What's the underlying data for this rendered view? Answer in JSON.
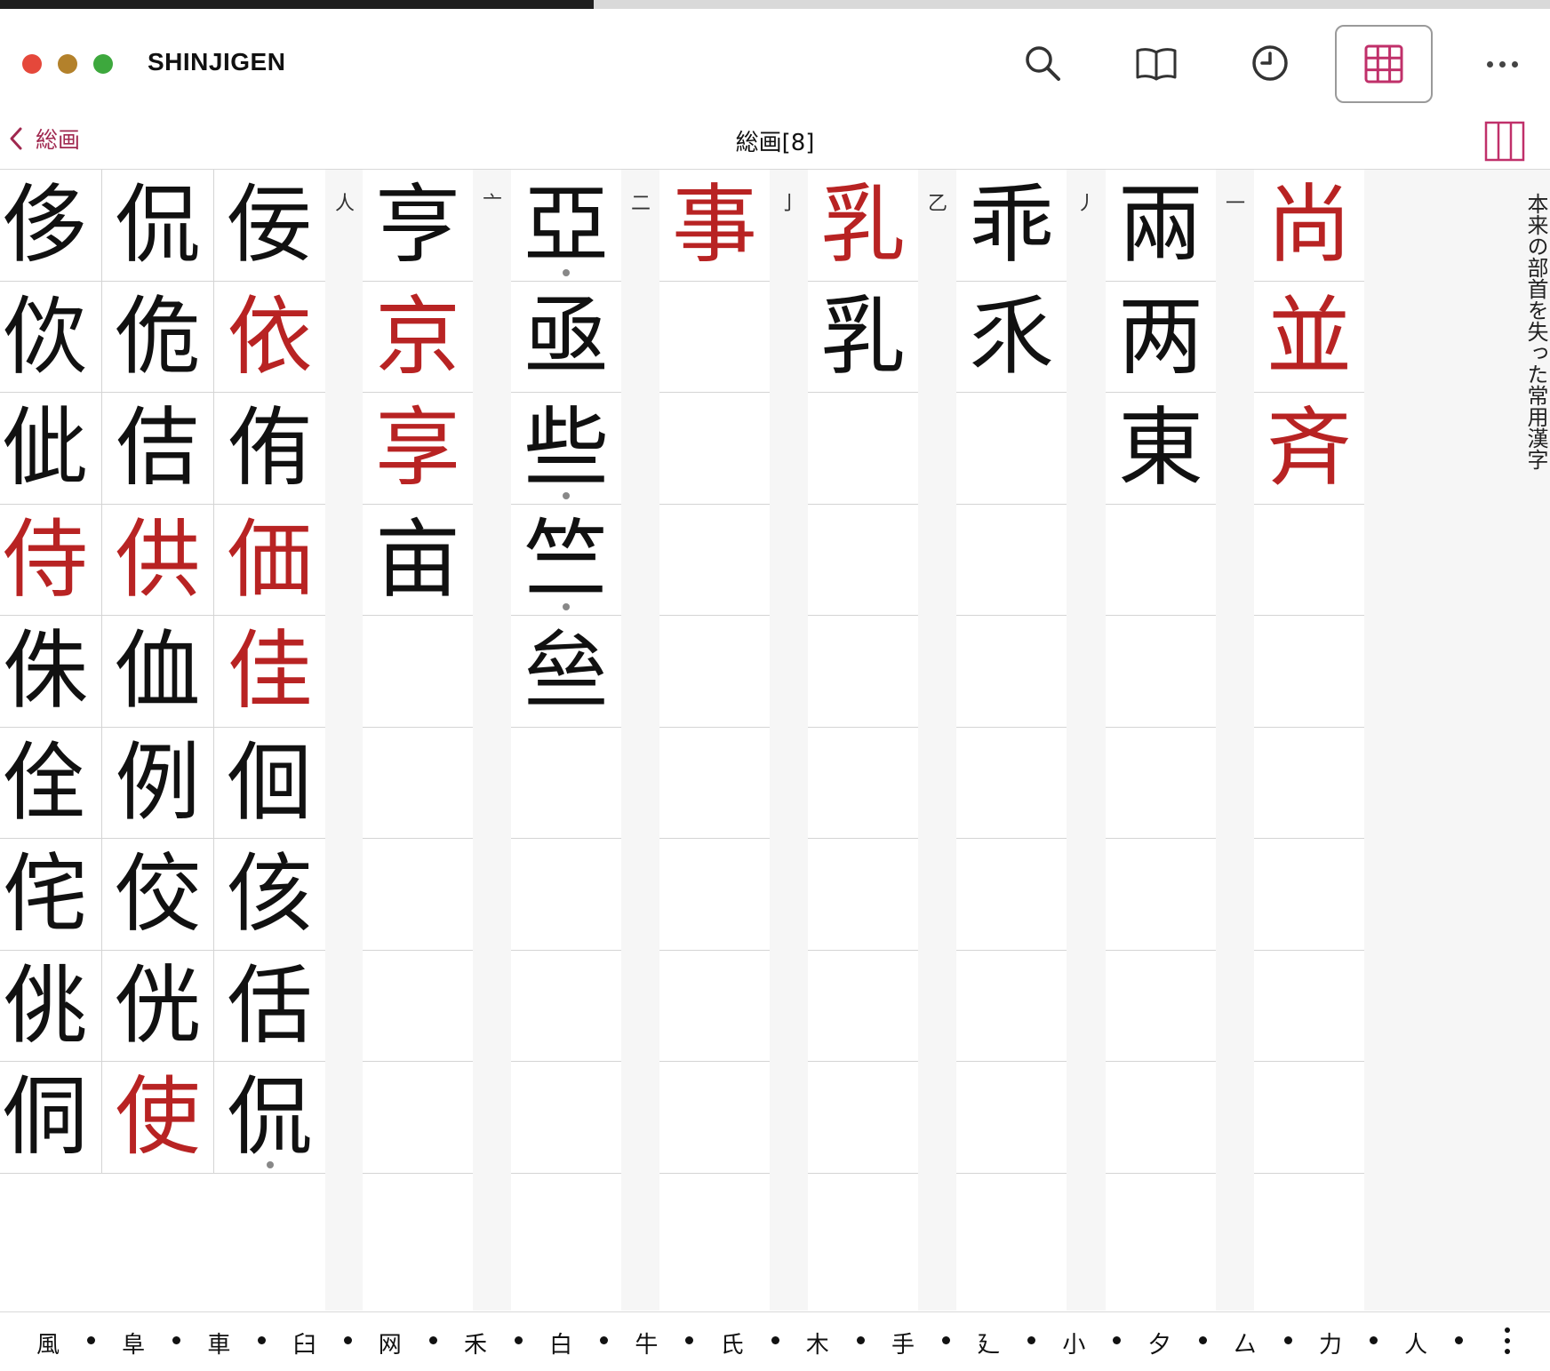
{
  "window": {
    "title": "SHINJIGEN"
  },
  "toolbar": {
    "search_icon": "search-icon",
    "book_icon": "book-icon",
    "history_icon": "clock-icon",
    "grid_icon": "grid-icon",
    "more_icon": "more-icon",
    "accent_color": "#c0306a"
  },
  "nav": {
    "back_label": "総画",
    "title": "総画[8]"
  },
  "side_note": "本来の部首を失った常用漢字",
  "colors": {
    "joyo_red": "#b82323",
    "normal": "#111111"
  },
  "columns": [
    {
      "radical": "",
      "cells": [
        {
          "c": "侈",
          "red": false
        },
        {
          "c": "佽",
          "red": false
        },
        {
          "c": "佌",
          "red": false
        },
        {
          "c": "侍",
          "red": true
        },
        {
          "c": "侏",
          "red": false
        },
        {
          "c": "佺",
          "red": false
        },
        {
          "c": "侘",
          "red": false
        },
        {
          "c": "佻",
          "red": false
        },
        {
          "c": "侗",
          "red": false
        }
      ]
    },
    {
      "radical": "",
      "cells": [
        {
          "c": "侃",
          "red": false
        },
        {
          "c": "佹",
          "red": false
        },
        {
          "c": "佶",
          "red": false
        },
        {
          "c": "供",
          "red": true
        },
        {
          "c": "侐",
          "red": false
        },
        {
          "c": "例",
          "red": false
        },
        {
          "c": "佼",
          "red": false
        },
        {
          "c": "侊",
          "red": false
        },
        {
          "c": "使",
          "red": true
        }
      ]
    },
    {
      "radical": "人",
      "cells": [
        {
          "c": "佞",
          "red": false
        },
        {
          "c": "依",
          "red": true
        },
        {
          "c": "侑",
          "red": false
        },
        {
          "c": "価",
          "red": true
        },
        {
          "c": "佳",
          "red": true
        },
        {
          "c": "佪",
          "red": false
        },
        {
          "c": "侅",
          "red": false
        },
        {
          "c": "佸",
          "red": false
        },
        {
          "c": "侃",
          "red": false,
          "dot": true
        }
      ]
    },
    {
      "radical": "亠",
      "cells": [
        {
          "c": "亨",
          "red": false
        },
        {
          "c": "京",
          "red": true
        },
        {
          "c": "享",
          "red": true
        },
        {
          "c": "亩",
          "red": false
        }
      ]
    },
    {
      "radical": "二",
      "cells": [
        {
          "c": "亞",
          "red": false,
          "dot": true
        },
        {
          "c": "亟",
          "red": false
        },
        {
          "c": "些",
          "red": false,
          "dot": true
        },
        {
          "c": "竺",
          "red": false,
          "dot": true
        },
        {
          "c": "亝",
          "red": false
        }
      ]
    },
    {
      "radical": "亅",
      "cells": [
        {
          "c": "事",
          "red": true
        }
      ]
    },
    {
      "radical": "乙",
      "cells": [
        {
          "c": "乳",
          "red": true
        },
        {
          "c": "乳",
          "red": false
        }
      ]
    },
    {
      "radical": "丿",
      "cells": [
        {
          "c": "乖",
          "red": false
        },
        {
          "c": "乑",
          "red": false
        }
      ]
    },
    {
      "radical": "一",
      "cells": [
        {
          "c": "兩",
          "red": false
        },
        {
          "c": "两",
          "red": false
        },
        {
          "c": "東",
          "red": false
        }
      ]
    },
    {
      "radical": "",
      "cells": [
        {
          "c": "尚",
          "red": true
        },
        {
          "c": "並",
          "red": true
        },
        {
          "c": "斉",
          "red": true
        }
      ]
    }
  ],
  "bottom_radicals": [
    "風",
    "阜",
    "車",
    "臼",
    "网",
    "禾",
    "白",
    "牛",
    "氏",
    "木",
    "手",
    "廴",
    "小",
    "夕",
    "厶",
    "力",
    "人"
  ]
}
